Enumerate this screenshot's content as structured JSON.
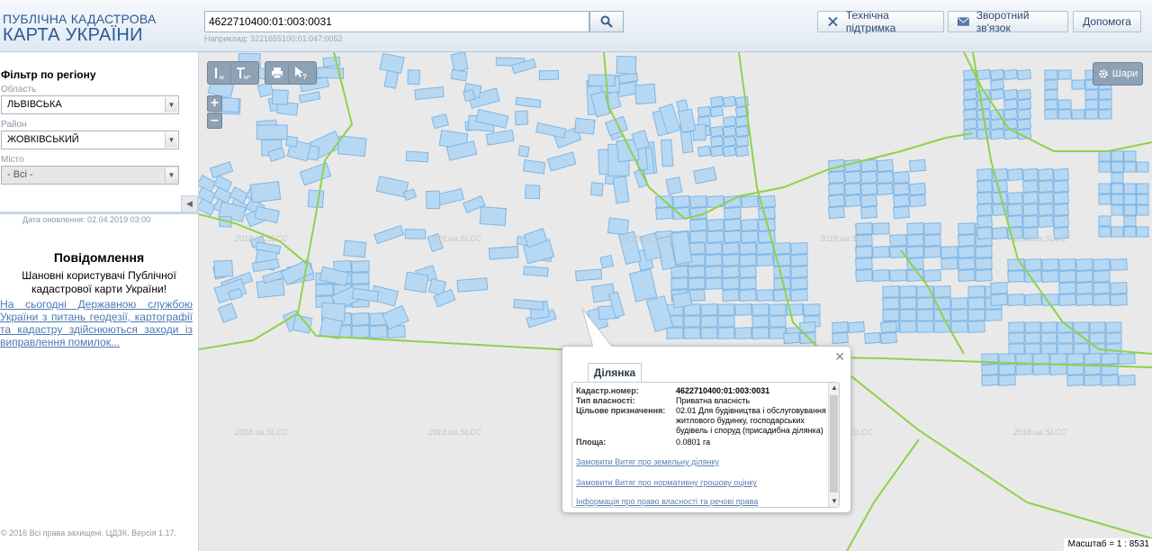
{
  "logo": {
    "line1": "ПУБЛІЧНА КАДАСТРОВА",
    "line2": "КАРТА УКРАЇНИ"
  },
  "search": {
    "value": "4622710400:01:003:0031",
    "hint": "Наприклад: 3221655100:01:047:0052"
  },
  "header_buttons": {
    "support": "Технічна підтримка",
    "feedback": "Зворотний зв'язок",
    "help": "Допомога"
  },
  "sidebar": {
    "filter_title": "Фільтр по регіону",
    "oblast_label": "Область",
    "oblast_value": "ЛЬВІВСЬКА",
    "rayon_label": "Район",
    "rayon_value": "ЖОВКІВСЬКИЙ",
    "city_label": "Місто",
    "city_value": "- Всі -",
    "update_date": "Дата оновлення: 02.04.2019 03:00",
    "news_title": "Повідомлення",
    "news_text": "Шановні користувачі Публічної кадастрової карти України!",
    "news_link": "На сьогодні Державною службою України з питань геодезії, картографії та кадастру здійснюються заходи із виправлення помилок...",
    "copyright": "© 2016 Всі права захищені. ЦДЗК. Версія 1.17."
  },
  "map": {
    "layers_label": "Шари",
    "scale": "Масштаб = 1 : 8531",
    "watermark": "2018.ua.SLCC",
    "colors": {
      "parcel_fill": "#b7d8f3",
      "parcel_stroke": "#7fb6e3",
      "boundary": "#8fd14a",
      "background": "#e9e9e9"
    }
  },
  "popup": {
    "tab": "Ділянка",
    "fields": [
      {
        "key": "Кадастр.номер:",
        "value": "4622710400:01:003:0031"
      },
      {
        "key": "Тип власності:",
        "value": "Приватна власність"
      },
      {
        "key": "Цільове призначення:",
        "value": "02.01 Для будівництва і обслуговування житлового будинку, господарських будівель і споруд (присадибна ділянка)"
      },
      {
        "key": "Площа:",
        "value": "0.0801 га"
      }
    ],
    "links": [
      "Замовити Витяг про земельну ділянку",
      "Замовити Витяг про нормативну грошову оцінку",
      "Інформація про право власності та речові права"
    ]
  }
}
